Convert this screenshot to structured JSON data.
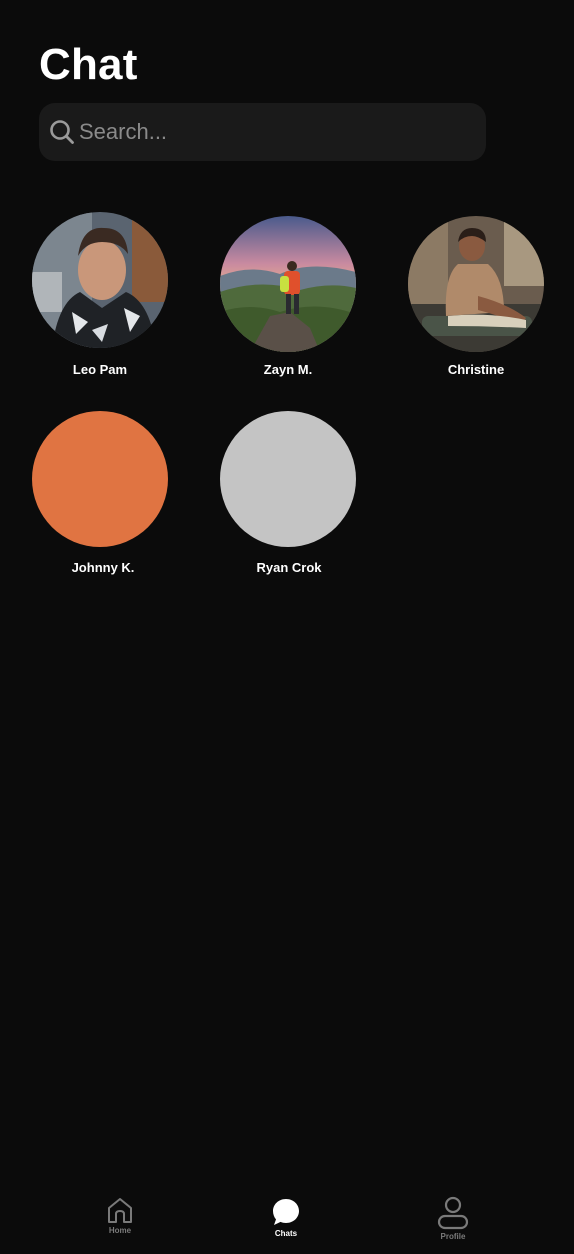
{
  "header": {
    "title": "Chat"
  },
  "search": {
    "placeholder": "Search..."
  },
  "contacts": [
    {
      "name": "Leo Pam",
      "avatar": "photo-man-snow-jacket"
    },
    {
      "name": "Zayn M.",
      "avatar": "photo-hiker-mountain"
    },
    {
      "name": "Christine",
      "avatar": "photo-woman-stretching"
    },
    {
      "name": "Johnny K.",
      "avatar": "placeholder-orange",
      "avatar_color": "#e07442"
    },
    {
      "name": "Ryan Crok",
      "avatar": "placeholder-gray",
      "avatar_color": "#c4c4c4"
    }
  ],
  "bottom_nav": {
    "items": [
      {
        "label": "Home",
        "icon": "home-icon",
        "active": false
      },
      {
        "label": "Chats",
        "icon": "chat-bubble-icon",
        "active": true
      },
      {
        "label": "Profile",
        "icon": "profile-icon",
        "active": false
      }
    ]
  },
  "colors": {
    "background": "#0b0b0b",
    "search_bg": "#1a1a1a",
    "text": "#ffffff",
    "muted": "#7a7a7a"
  }
}
